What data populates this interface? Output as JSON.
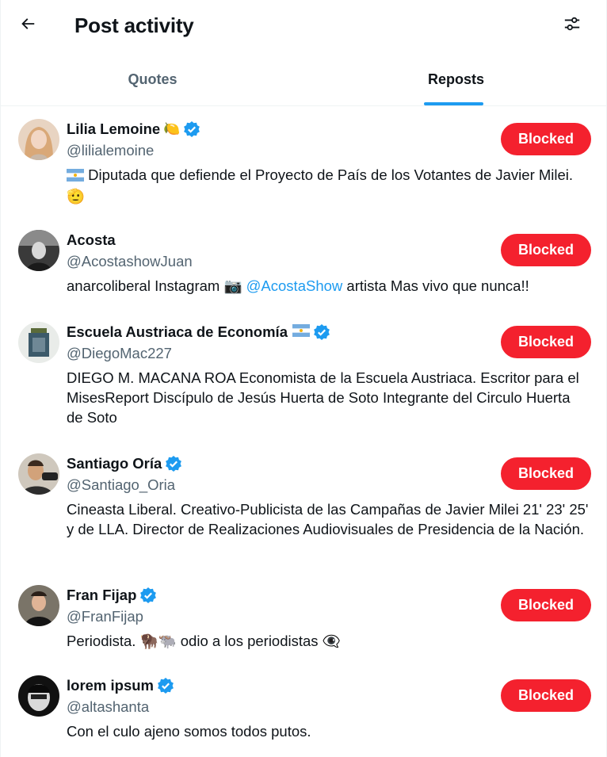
{
  "header": {
    "title": "Post activity",
    "back_icon": "arrow-left-icon",
    "filter_icon": "sliders-icon"
  },
  "tabs": [
    {
      "label": "Quotes",
      "active": false
    },
    {
      "label": "Reposts",
      "active": true
    }
  ],
  "colors": {
    "accent": "#1d9bf0",
    "blocked": "#f4212e",
    "secondary_text": "#536471"
  },
  "users": [
    {
      "name": "Lilia Lemoine",
      "name_emoji": "🍋",
      "verified": true,
      "handle": "@lilialemoine",
      "bio_prefix": "",
      "bio": "Diputada que defiende el Proyecto de País de los Votantes de Javier Milei. 🫡",
      "button": "Blocked"
    },
    {
      "name": "Acosta",
      "name_emoji": "",
      "verified": false,
      "handle": "@AcostashowJuan",
      "bio_prefix": "anarcoliberal Instagram 📷",
      "bio_mention": "@AcostaShow",
      "bio": "artista Mas vivo que nunca!!",
      "button": "Blocked"
    },
    {
      "name": "Escuela Austriaca de Economía",
      "name_emoji": "",
      "verified": true,
      "handle": "@DiegoMac227",
      "bio": "DIEGO M. MACANA ROA Economista de la Escuela Austriaca. Escritor para el MisesReport Discípulo de Jesús Huerta de Soto Integrante del Circulo Huerta de Soto",
      "button": "Blocked"
    },
    {
      "name": "Santiago Oría",
      "name_emoji": "",
      "verified": true,
      "handle": "@Santiago_Oria",
      "bio": "Cineasta Liberal. Creativo-Publicista de las Campañas de Javier Milei 21' 23' 25' y de LLA. Director de Realizaciones Audiovisuales de Presidencia de la Nación.",
      "button": "Blocked"
    },
    {
      "name": "Fran Fijap",
      "name_emoji": "",
      "verified": true,
      "handle": "@FranFijap",
      "bio": "Periodista. 🦬🐃 odio a los periodistas 👁‍🗨",
      "button": "Blocked"
    },
    {
      "name": "lorem ipsum",
      "name_emoji": "",
      "verified": true,
      "handle": "@altashanta",
      "bio": "Con el culo ajeno somos todos putos.",
      "button": "Blocked"
    }
  ]
}
